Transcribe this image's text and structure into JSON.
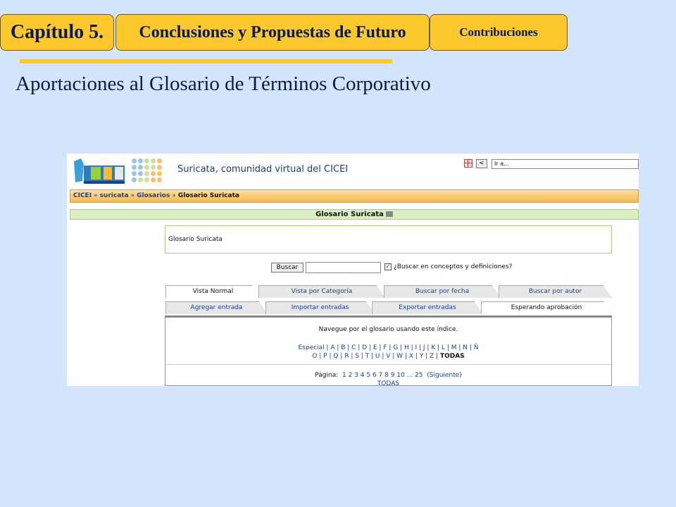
{
  "header": {
    "chapter": "Capítulo 5.",
    "section": "Conclusiones y Propuestas de Futuro",
    "subsection": "Contribuciones"
  },
  "slide_title": "Aportaciones al Glosario de Términos Corporativo",
  "colors": {
    "background": "#d4e4fb",
    "header_fill": "#fdc82b",
    "header_text": "#0a1a4a"
  },
  "screenshot": {
    "logo_icon": "iva-logo",
    "site_name": "Suricata, comunidad virtual del CICEI",
    "jump_select": "Ir a...",
    "back_button": "<",
    "breadcrumb": {
      "home": "CICEI",
      "course": "suricata",
      "module": "Glosarios",
      "current": "Glosario Suricata",
      "separator": "»"
    },
    "page_title": "Glosario Suricata",
    "description": "Glosario Suricata",
    "search": {
      "button": "Buscar",
      "input_value": "",
      "checkbox_checked": true,
      "checkbox_label": "¿Buscar en conceptos y definiciones?"
    },
    "tabs_row1": [
      "Vista Normal",
      "Vista por Categoría",
      "Buscar por fecha",
      "Buscar por autor"
    ],
    "tabs_row2": [
      "Agregar entrada",
      "Importar entradas",
      "Exportar entradas",
      "Esperando aprobación"
    ],
    "index": {
      "instruction": "Navegue por el glosario usando este índice.",
      "letters_line1": "Especial | A | B | C | D | E | F | G | H | I | J | K | L | M | N | Ñ",
      "letters_line2": "O | P | Q | R | S | T | U | V | W | X | Y | Z |",
      "all": "TODAS",
      "page_label": "Página:",
      "pages": "1  2  3  4  5  6  7  8  9  10  ...  25",
      "next": "(Siguiente)",
      "pages_all": "TODAS"
    }
  }
}
